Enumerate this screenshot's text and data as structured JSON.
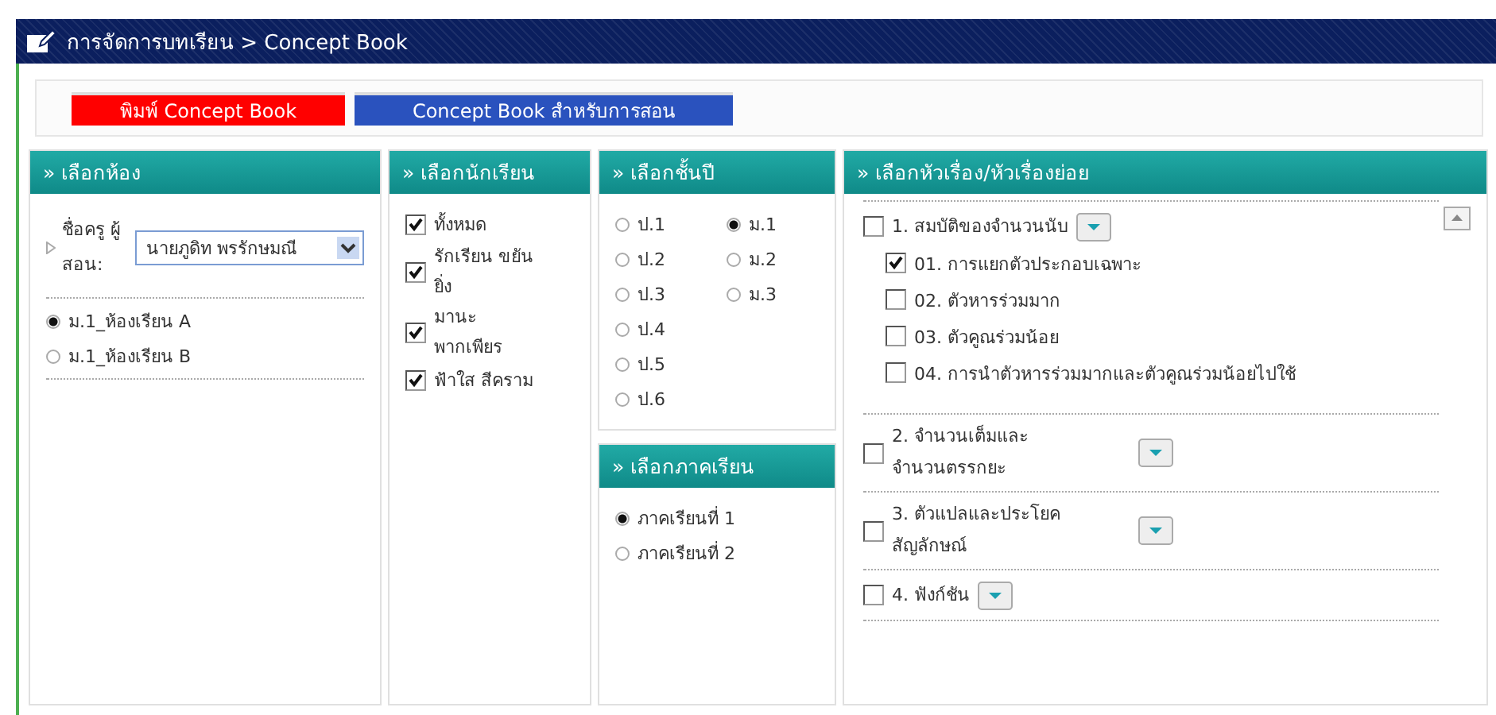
{
  "title_bar": {
    "title": "การจัดการบทเรียน > Concept Book"
  },
  "action_buttons": [
    {
      "label": "พิมพ์ Concept Book",
      "color": "#ff0000"
    },
    {
      "label": "Concept Book สำหรับการสอน",
      "color": "#2a52be"
    }
  ],
  "room_panel": {
    "header": "» เลือกห้อง",
    "teacher_label": "ชื่อครู ผู้ สอน:",
    "teacher_select": {
      "value": "นายภูดิท พรรักษมณี"
    },
    "rooms": [
      {
        "label": "ม.1_ห้องเรียน A",
        "selected": true
      },
      {
        "label": "ม.1_ห้องเรียน B",
        "selected": false
      }
    ]
  },
  "student_panel": {
    "header": "» เลือกนักเรียน",
    "students": [
      {
        "label": "ทั้งหมด",
        "checked": true
      },
      {
        "label": "รักเรียน ขยันยิ่ง",
        "checked": true
      },
      {
        "label": "มานะ พากเพียร",
        "checked": true
      },
      {
        "label": "ฟ้าใส สีคราม",
        "checked": true
      }
    ]
  },
  "grade_panel": {
    "header": "» เลือกชั้นปี",
    "grades": [
      {
        "label": "ป.1",
        "selected": false
      },
      {
        "label": "ป.2",
        "selected": false
      },
      {
        "label": "ป.3",
        "selected": false
      },
      {
        "label": "ป.4",
        "selected": false
      },
      {
        "label": "ป.5",
        "selected": false
      },
      {
        "label": "ป.6",
        "selected": false
      },
      {
        "label": "ม.1",
        "selected": true
      },
      {
        "label": "ม.2",
        "selected": false
      },
      {
        "label": "ม.3",
        "selected": false
      }
    ]
  },
  "semester_panel": {
    "header": "» เลือกภาคเรียน",
    "semesters": [
      {
        "label": "ภาคเรียนที่ 1",
        "selected": true
      },
      {
        "label": "ภาคเรียนที่ 2",
        "selected": false
      }
    ]
  },
  "topic_panel": {
    "header": "» เลือกหัวเรื่อง/หัวเรื่องย่อย",
    "topics": [
      {
        "label": "1. สมบัติของจำนวนนับ",
        "checked": false,
        "children": [
          {
            "label": "01. การแยกตัวประกอบเฉพาะ",
            "checked": true
          },
          {
            "label": "02. ตัวหารร่วมมาก",
            "checked": false
          },
          {
            "label": "03. ตัวคูณร่วมน้อย",
            "checked": false
          },
          {
            "label": "04. การนำตัวหารร่วมมากและตัวคูณร่วมน้อยไปใช้",
            "checked": false
          }
        ]
      },
      {
        "label": "2. จำนวนเต็มและจำนวนตรรกยะ",
        "checked": false
      },
      {
        "label": "3. ตัวแปลและประโยคสัญลักษณ์",
        "checked": false
      },
      {
        "label": "4. ฟังก์ชัน",
        "checked": false
      }
    ]
  }
}
